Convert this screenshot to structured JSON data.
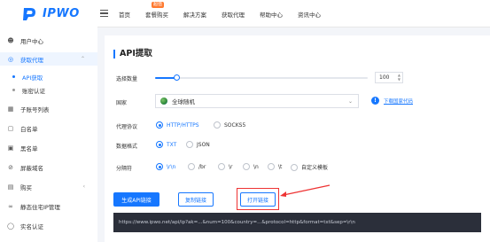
{
  "brand": {
    "logo_text": "IPWO",
    "accent": "#1677ff"
  },
  "topnav": {
    "items": [
      {
        "label": "首页"
      },
      {
        "label": "套餐购买",
        "badge": "超值"
      },
      {
        "label": "解决方案"
      },
      {
        "label": "获取代理"
      },
      {
        "label": "帮助中心"
      },
      {
        "label": "资讯中心"
      }
    ]
  },
  "sidebar": {
    "items": [
      {
        "label": "用户中心",
        "icon": "user-icon"
      },
      {
        "label": "获取代理",
        "icon": "location-icon",
        "active": true
      },
      {
        "label": "API获取",
        "sub": true,
        "active": true
      },
      {
        "label": "账密认证",
        "sub": true
      },
      {
        "label": "子账号列表",
        "icon": "account-card-icon"
      },
      {
        "label": "白名单",
        "icon": "whitelist-icon"
      },
      {
        "label": "黑名单",
        "icon": "blacklist-icon"
      },
      {
        "label": "屏蔽域名",
        "icon": "block-icon"
      },
      {
        "label": "购买",
        "icon": "calendar-icon"
      },
      {
        "label": "静态住宅IP管理",
        "icon": "infinity-icon"
      },
      {
        "label": "实名认证",
        "icon": "shield-check-icon"
      }
    ]
  },
  "main": {
    "title": "API提取",
    "fields": {
      "quantity": {
        "label": "选择数量",
        "value": "100",
        "fraction": 0.1
      },
      "country": {
        "label": "国家",
        "value": "全球随机",
        "download_link": "下载国家代码"
      },
      "protocol": {
        "label": "代理协议",
        "options": [
          "HTTP/HTTPS",
          "SOCKS5"
        ],
        "selected": 0
      },
      "format": {
        "label": "数据格式",
        "options": [
          "TXT",
          "JSON"
        ],
        "selected": 0
      },
      "separator": {
        "label": "分隔符",
        "options": [
          "\\r\\n",
          "/br",
          "\\r",
          "\\n",
          "\\t",
          "自定义模板"
        ],
        "selected": 0
      }
    },
    "buttons": {
      "generate": "生成API链接",
      "copy": "复制链接",
      "open": "打开链接"
    },
    "link_text": "https://www.ipwo.net/api/ip?ak=...&num=100&country=...&protocol=http&format=txt&sep=\\r\\n"
  }
}
